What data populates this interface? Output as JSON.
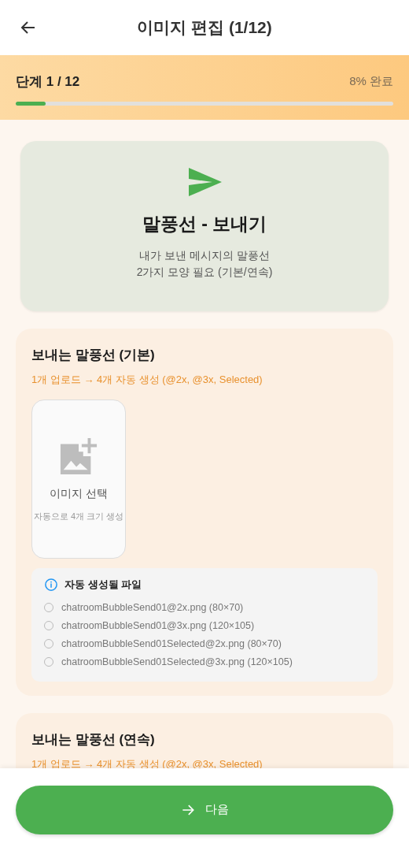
{
  "header": {
    "title": "이미지 편집 (1/12)"
  },
  "progress": {
    "step": "단계 1 / 12",
    "percent": "8% 완료",
    "level": 0.08
  },
  "intro": {
    "title": "말풍선 - 보내기",
    "lines": [
      "내가 보낸 메시지의 말풍선",
      "2가지 모양 필요 (기본/연속)"
    ]
  },
  "sections": [
    {
      "title": "보내는 말풍선 (기본)",
      "subtitle": "1개 업로드 → 4개 자동 생성 (@2x, @3x, Selected)",
      "picker": {
        "label": "이미지 선택",
        "hint": "자동으로 4개 크기 생성"
      },
      "files_title": "자동 생성될 파일",
      "files": [
        {
          "name": "chatroomBubbleSend01@2x.png (80×70)",
          "checked": false
        },
        {
          "name": "chatroomBubbleSend01@3x.png (120×105)",
          "checked": false
        },
        {
          "name": "chatroomBubbleSend01Selected@2x.png (80×70)",
          "checked": false
        },
        {
          "name": "chatroomBubbleSend01Selected@3x.png (120×105)",
          "checked": false
        }
      ]
    },
    {
      "title": "보내는 말풍선 (연속)",
      "subtitle": "1개 업로드 → 4개 자동 생성 (@2x, @3x, Selected)"
    }
  ],
  "next_button": {
    "label": "다음"
  }
}
